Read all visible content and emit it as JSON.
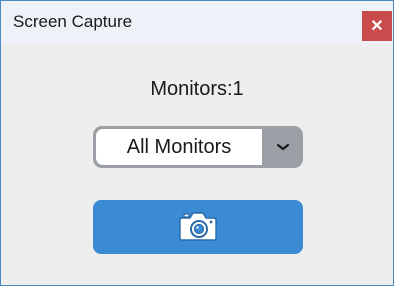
{
  "window": {
    "title": "Screen Capture",
    "close_icon": "close-icon"
  },
  "main": {
    "monitors_label": "Monitors:1",
    "monitor_select": {
      "value": "All Monitors",
      "icon": "chevron-down-icon"
    },
    "capture_button": {
      "icon": "camera-icon"
    }
  },
  "colors": {
    "accent": "#3a8bd4",
    "close": "#c94b4b"
  }
}
